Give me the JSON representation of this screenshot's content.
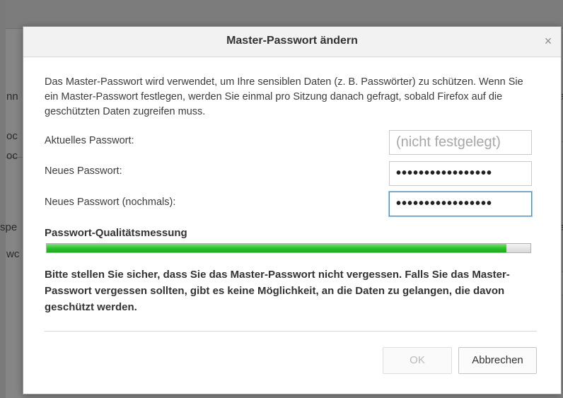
{
  "background": {
    "fragments": [
      "nn",
      "oc",
      "oc",
      "spe",
      "wc",
      "a",
      "a",
      "o"
    ]
  },
  "dialog": {
    "title": "Master-Passwort ändern",
    "close_glyph": "×",
    "description": "Das Master-Passwort wird verwendet, um Ihre sensiblen Daten (z. B. Passwörter) zu schützen. Wenn Sie ein Master-Passwort festlegen, werden Sie einmal pro Sitzung danach gefragt, sobald Firefox auf die geschützten Daten zugreifen muss.",
    "fields": {
      "current_label": "Aktuelles Passwort:",
      "current_value": "(nicht festgelegt)",
      "new_label": "Neues Passwort:",
      "new_value": "•••••••••••••••••",
      "confirm_label": "Neues Passwort (nochmals):",
      "confirm_value": "•••••••••••••••••"
    },
    "quality": {
      "label": "Passwort-Qualitätsmessung",
      "level_fraction": 0.95
    },
    "warning": "Bitte stellen Sie sicher, dass Sie das Master-Passwort nicht vergessen. Falls Sie das Master-Passwort vergessen sollten, gibt es keine Möglichkeit, an die Daten zu gelangen, die davon geschützt werden.",
    "buttons": {
      "ok_label": "OK",
      "ok_enabled": false,
      "cancel_label": "Abbrechen"
    }
  },
  "colors": {
    "meter_green": "#2bc42b",
    "focus_blue": "#3c94d6"
  }
}
